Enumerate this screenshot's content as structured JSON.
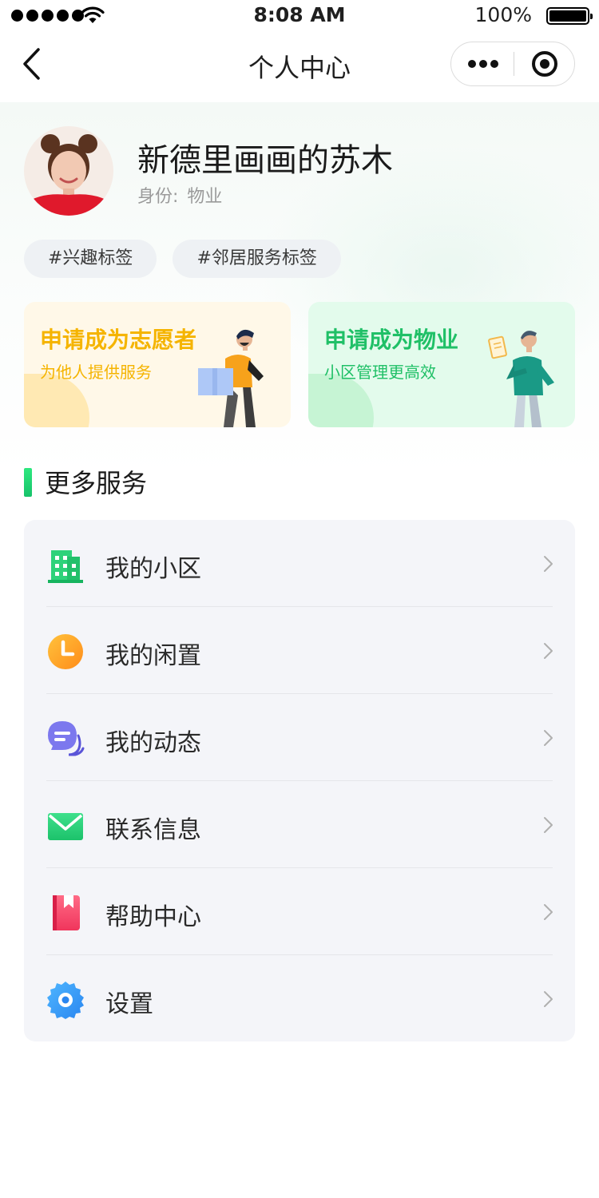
{
  "status_bar": {
    "time": "8:08 AM",
    "battery": "100%"
  },
  "nav": {
    "title": "个人中心"
  },
  "profile": {
    "name": "新德里画画的苏木",
    "role_label": "身份:",
    "role_value": "物业",
    "tags": [
      "#兴趣标签",
      "#邻居服务标签"
    ]
  },
  "cards": {
    "volunteer": {
      "title": "申请成为志愿者",
      "subtitle": "为他人提供服务",
      "color": "#f5b400"
    },
    "property": {
      "title": "申请成为物业",
      "subtitle": "小区管理更高效",
      "color": "#20c067"
    }
  },
  "section": {
    "title": "更多服务",
    "accent": "#1fd26f"
  },
  "menu": {
    "items": [
      {
        "label": "我的小区",
        "icon": "building-icon"
      },
      {
        "label": "我的闲置",
        "icon": "clock-icon"
      },
      {
        "label": "我的动态",
        "icon": "chat-bubble-icon"
      },
      {
        "label": "联系信息",
        "icon": "envelope-icon"
      },
      {
        "label": "帮助中心",
        "icon": "bookmark-book-icon"
      },
      {
        "label": "设置",
        "icon": "gear-icon"
      }
    ]
  }
}
